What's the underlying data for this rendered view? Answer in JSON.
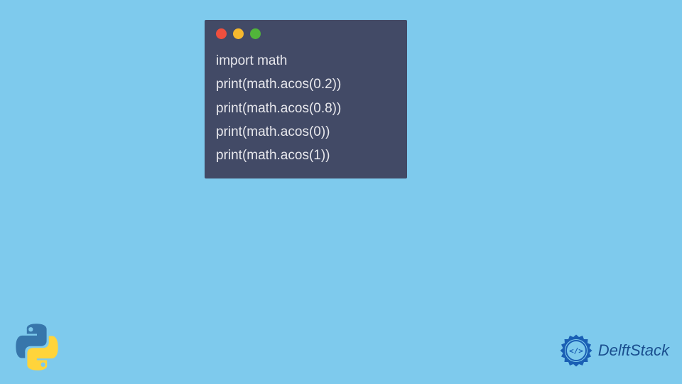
{
  "code": {
    "lines": [
      "import math",
      "print(math.acos(0.2))",
      "print(math.acos(0.8))",
      "print(math.acos(0))",
      "print(math.acos(1))"
    ]
  },
  "branding": {
    "text": "DelftStack"
  },
  "colors": {
    "background": "#7ecaed",
    "codeWindow": "#424a66",
    "codeText": "#e8e8ed",
    "trafficRed": "#ee4f3e",
    "trafficYellow": "#f5b82e",
    "trafficGreen": "#51b53a",
    "brandBlue": "#1a4f8f"
  }
}
